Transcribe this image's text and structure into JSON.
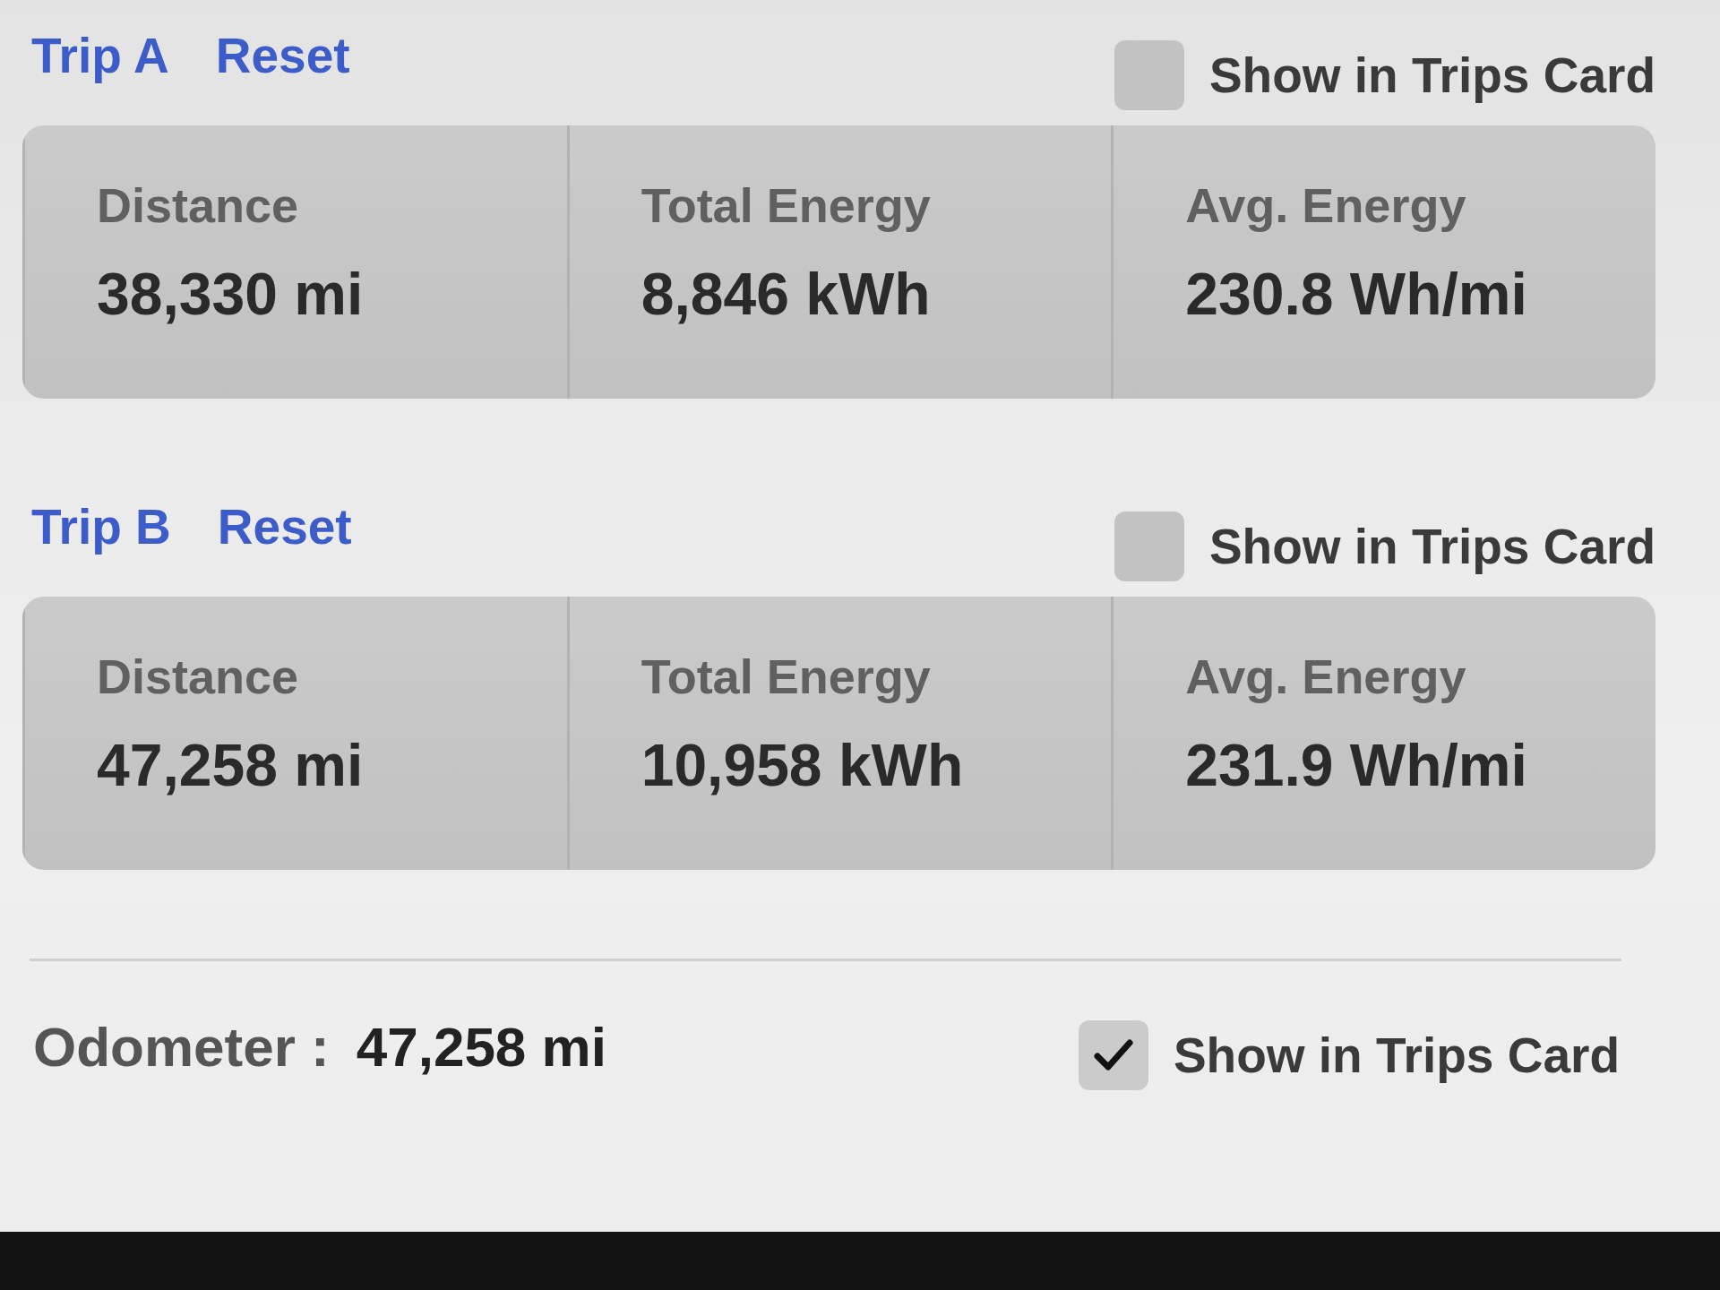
{
  "trips": [
    {
      "title": "Trip A",
      "reset": "Reset",
      "show_in_trips_card": {
        "label": "Show in Trips Card",
        "checked": false
      },
      "stats": [
        {
          "label": "Distance",
          "value": "38,330 mi"
        },
        {
          "label": "Total Energy",
          "value": "8,846 kWh"
        },
        {
          "label": "Avg. Energy",
          "value": "230.8 Wh/mi"
        }
      ]
    },
    {
      "title": "Trip B",
      "reset": "Reset",
      "show_in_trips_card": {
        "label": "Show in Trips Card",
        "checked": false
      },
      "stats": [
        {
          "label": "Distance",
          "value": "47,258 mi"
        },
        {
          "label": "Total Energy",
          "value": "10,958 kWh"
        },
        {
          "label": "Avg. Energy",
          "value": "231.9 Wh/mi"
        }
      ]
    }
  ],
  "odometer": {
    "label": "Odometer :",
    "value": "47,258 mi",
    "show_in_trips_card": {
      "label": "Show in Trips Card",
      "checked": true
    }
  }
}
